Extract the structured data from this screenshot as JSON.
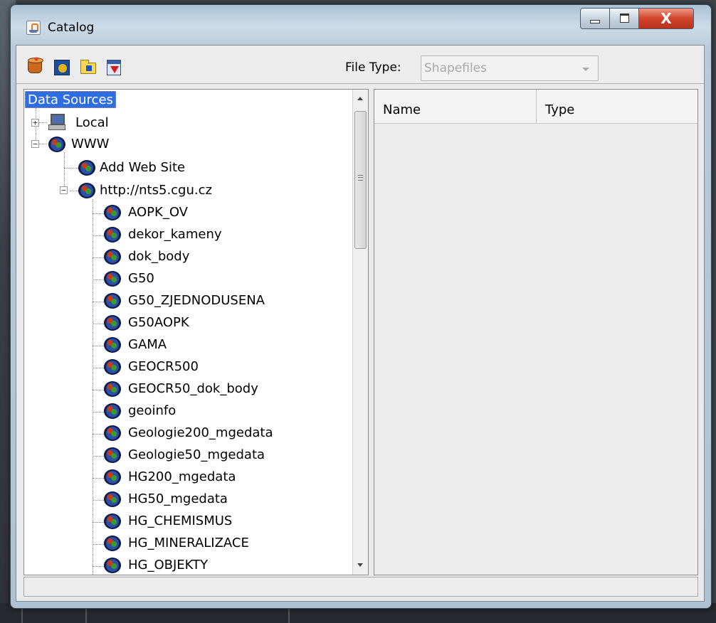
{
  "window": {
    "title": "Catalog",
    "close_glyph": "X"
  },
  "toolbar": {
    "buttons": [
      {
        "icon": "add-database-icon"
      },
      {
        "icon": "connect-web-icon"
      },
      {
        "icon": "open-folder-icon"
      },
      {
        "icon": "export-icon"
      }
    ],
    "file_type_label": "File Type:",
    "file_type_value": "Shapefiles"
  },
  "tree": {
    "root": "Data Sources",
    "local": "Local",
    "www": "WWW",
    "add_web_site": "Add Web Site",
    "server": "http://nts5.cgu.cz",
    "layers": [
      "AOPK_OV",
      "dekor_kameny",
      "dok_body",
      "G50",
      "G50_ZJEDNODUSENA",
      "G50AOPK",
      "GAMA",
      "GEOCR500",
      "GEOCR50_dok_body",
      "geoinfo",
      "Geologie200_mgedata",
      "Geologie50_mgedata",
      "HG200_mgedata",
      "HG50_mgedata",
      "HG_CHEMISMUS",
      "HG_MINERALIZACE",
      "HG_OBJEKTY"
    ],
    "expand_plus": "+",
    "expand_minus": "−"
  },
  "list": {
    "columns": [
      "Name",
      "Type"
    ]
  },
  "colors": {
    "selection": "#2f6ee0",
    "title_gradient": "#cddbe8",
    "close_button": "#d2432a"
  }
}
